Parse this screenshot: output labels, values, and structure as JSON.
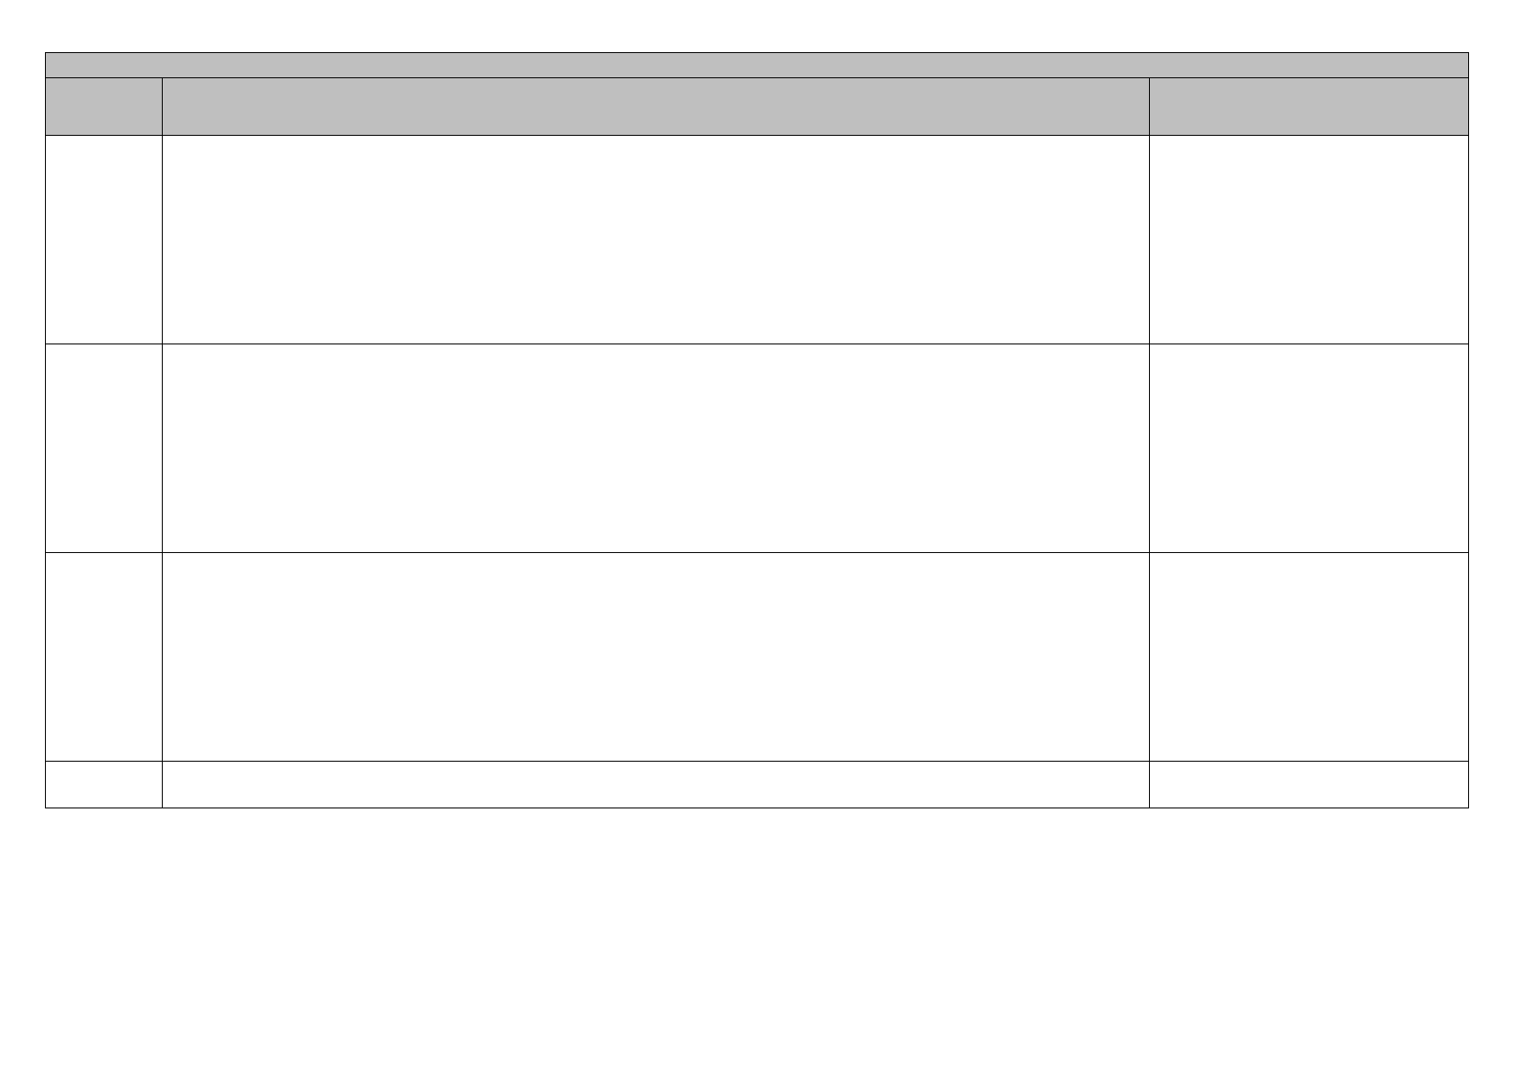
{
  "table": {
    "title": "",
    "headers": [
      "",
      "",
      ""
    ],
    "rows": [
      [
        "",
        "",
        ""
      ],
      [
        "",
        "",
        ""
      ],
      [
        "",
        "",
        ""
      ],
      [
        "",
        "",
        ""
      ]
    ]
  }
}
